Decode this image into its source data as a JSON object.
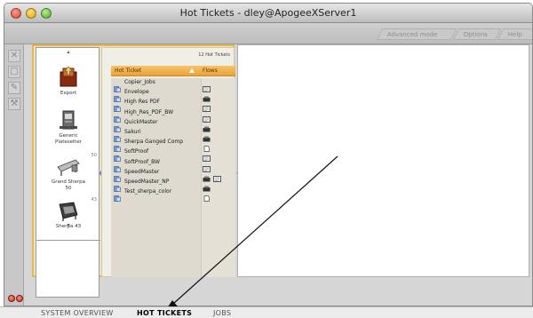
{
  "window": {
    "title": "Hot Tickets - dley@ApogeeXServer1"
  },
  "toolbar": {
    "tabs": [
      "Advanced mode",
      "Options",
      "Help"
    ]
  },
  "devices": [
    {
      "label": "Export",
      "number": "",
      "icon": "export-icon"
    },
    {
      "label": "Generic\nPlatesetter",
      "number": "",
      "icon": "platesetter-icon"
    },
    {
      "label": "Grand Sherpa\n50",
      "number": "50",
      "icon": "printer-icon"
    },
    {
      "label": "Sherpa 43",
      "number": "43",
      "icon": "printer-icon"
    }
  ],
  "hot_tickets": {
    "count": "12 Hot Tickets",
    "col_name": "Hot Ticket",
    "col_flows": "Flows",
    "rows": [
      {
        "name": "Copier_Jobs",
        "flows": [
          "flow-icon"
        ]
      },
      {
        "name": "Envelope",
        "flows": [
          "printer-flow-icon"
        ]
      },
      {
        "name": "High Res PDF",
        "flows": [
          "flow-icon"
        ]
      },
      {
        "name": "High_Res_PDF_BW",
        "flows": [
          "flow-icon"
        ]
      },
      {
        "name": "QuickMaster",
        "flows": [
          "printer-flow-icon"
        ]
      },
      {
        "name": "Sakuri",
        "flows": [
          "printer-flow-icon"
        ]
      },
      {
        "name": "Sherpa Ganged Comp",
        "flows": [
          "page-icon"
        ]
      },
      {
        "name": "SoftProof",
        "flows": [
          "flow-icon"
        ]
      },
      {
        "name": "SoftProof_BW",
        "flows": [
          "flow-icon"
        ]
      },
      {
        "name": "SpeedMaster",
        "flows": [
          "printer-flow-icon",
          "flow-icon"
        ]
      },
      {
        "name": "SpeedMaster_NP",
        "flows": [
          "printer-flow-icon"
        ]
      },
      {
        "name": "Test_sherpa_color",
        "flows": [
          "page-icon"
        ]
      }
    ]
  },
  "bottom_tabs": [
    "SYSTEM OVERVIEW",
    "HOT TICKETS",
    "JOBS"
  ],
  "colors": {
    "accent": "#e7b74f",
    "header": "#eea845"
  }
}
